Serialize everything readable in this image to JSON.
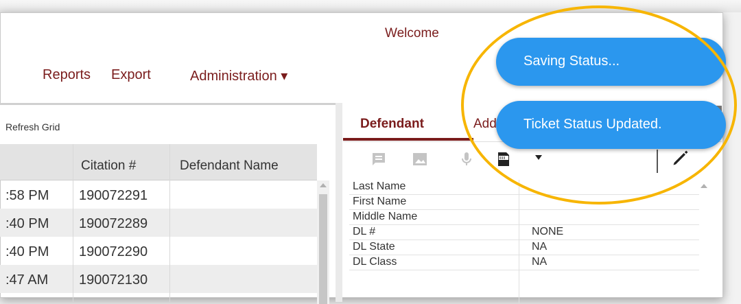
{
  "header": {
    "welcome": "Welcome"
  },
  "nav": {
    "reports": "Reports",
    "export": "Export",
    "administration": "Administration ▾"
  },
  "toolbar": {
    "refresh": "Refresh Grid"
  },
  "grid": {
    "headers": {
      "citation": "Citation #",
      "defendant": "Defendant Name"
    },
    "rows": [
      {
        "time": ":58 PM",
        "citation": "190072291"
      },
      {
        "time": ":40 PM",
        "citation": "190072289"
      },
      {
        "time": ":40 PM",
        "citation": "190072290"
      },
      {
        "time": ":47 AM",
        "citation": "190072130"
      }
    ]
  },
  "tabs": {
    "defendant": "Defendant",
    "add": "Add"
  },
  "fields": [
    {
      "label": "Last Name",
      "value": ""
    },
    {
      "label": "First Name",
      "value": ""
    },
    {
      "label": "Middle Name",
      "value": ""
    },
    {
      "label": "DL #",
      "value": "NONE"
    },
    {
      "label": "DL State",
      "value": "NA"
    },
    {
      "label": "DL Class",
      "value": "NA"
    }
  ],
  "toasts": {
    "saving": "Saving Status...",
    "updated": "Ticket Status Updated."
  },
  "colors": {
    "brand": "#7a1c1c",
    "toast": "#2b97ee",
    "highlight": "#f7b500"
  }
}
